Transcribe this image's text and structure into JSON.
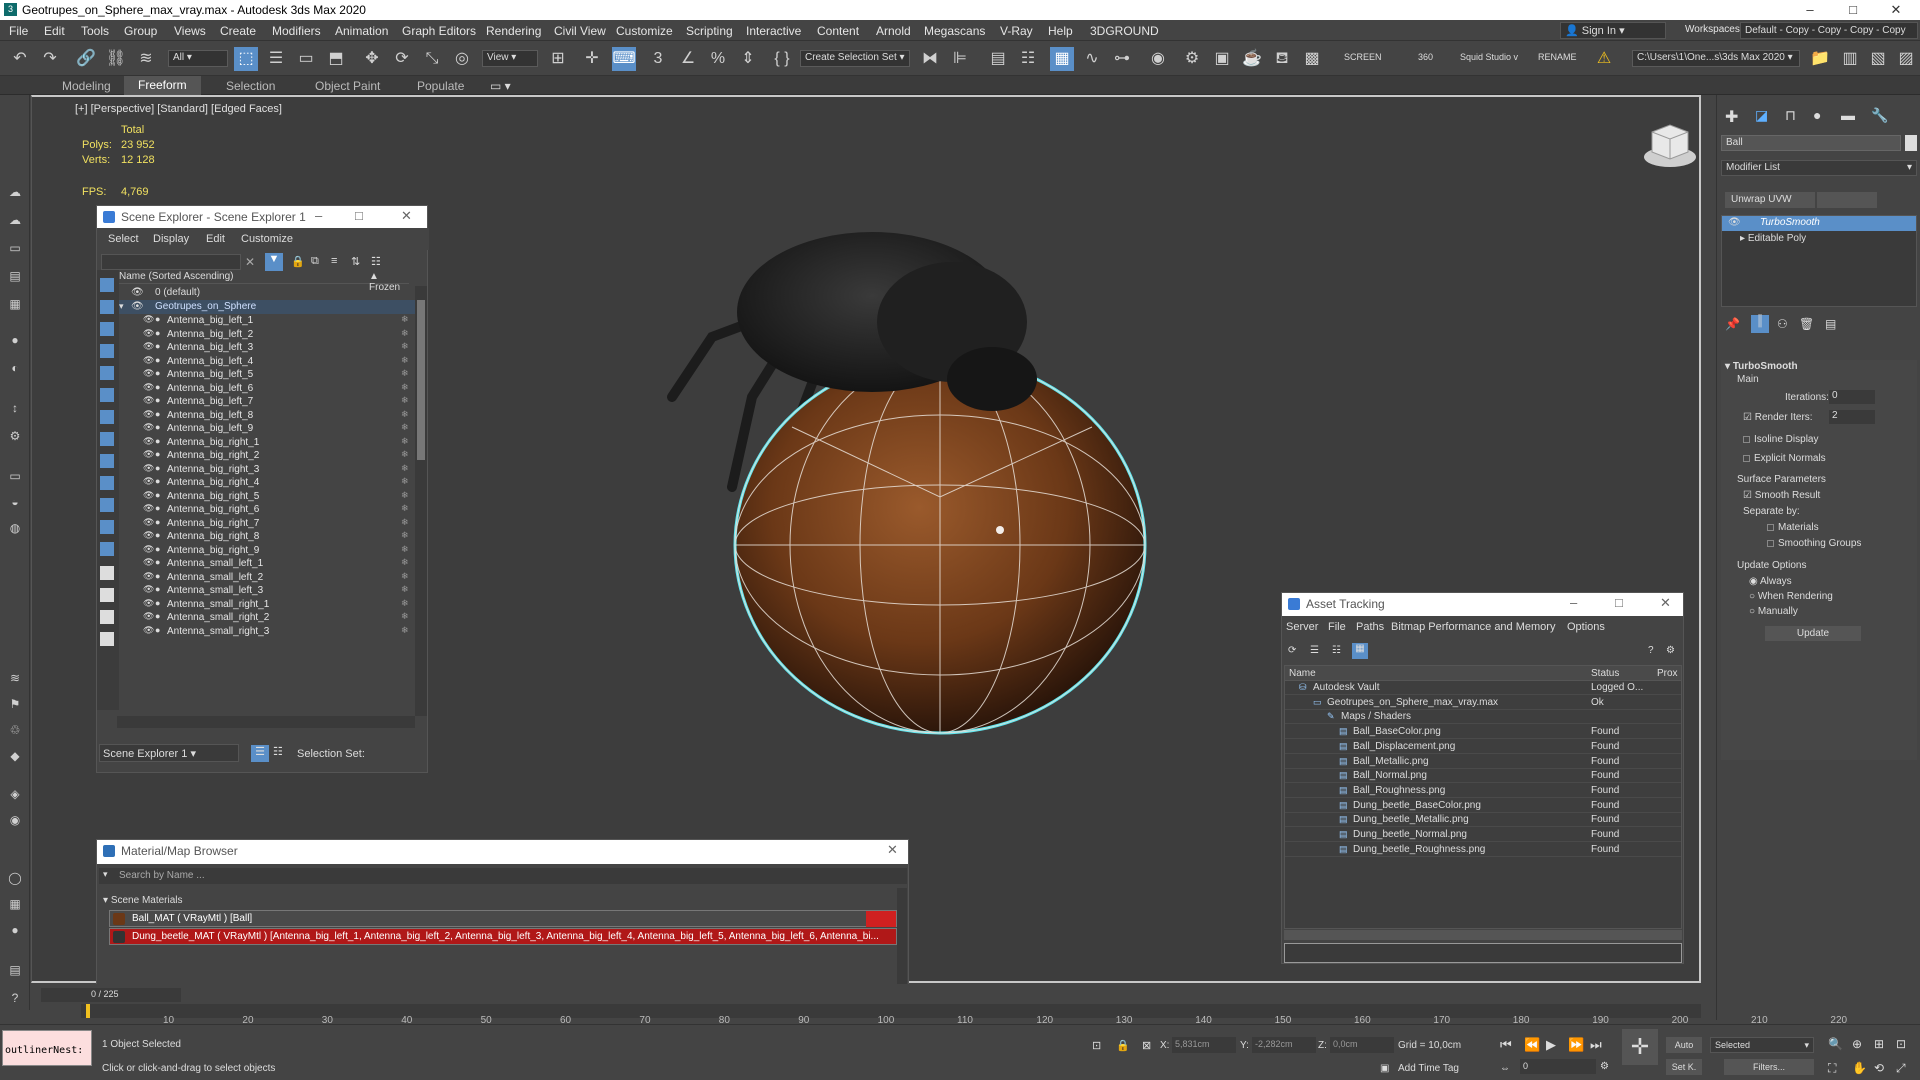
{
  "window": {
    "title": "Geotrupes_on_Sphere_max_vray.max - Autodesk 3ds Max 2020",
    "icon": "3",
    "min": "–",
    "max": "□",
    "close": "✕"
  },
  "menu": [
    "File",
    "Edit",
    "Tools",
    "Group",
    "Views",
    "Create",
    "Modifiers",
    "Animation",
    "Graph Editors",
    "Rendering",
    "Civil View",
    "Customize",
    "Scripting",
    "Interactive",
    "Content",
    "Arnold",
    "Megascans",
    "V-Ray",
    "Help",
    "3DGROUND"
  ],
  "signin": "Sign In",
  "workspace": {
    "label": "Workspaces:",
    "value": "Default - Copy - Copy - Copy - Copy"
  },
  "toolbar": {
    "filter": "All",
    "view": "View",
    "selset": "Create Selection Set",
    "screen": "SCREEN",
    "num": "360",
    "squid": "Squid Studio v",
    "rename": "RENAME",
    "path": "C:\\Users\\1\\One...s\\3ds Max 2020"
  },
  "ribbon": {
    "tabs": [
      "Modeling",
      "Freeform",
      "Selection",
      "Object Paint",
      "Populate"
    ],
    "active": "Freeform"
  },
  "viewport": {
    "label": "[+] [Perspective] [Standard] [Edged Faces]",
    "total": "Total",
    "polys_label": "Polys:",
    "polys": "23 952",
    "verts_label": "Verts:",
    "verts": "12 128",
    "fps_label": "FPS:",
    "fps": "4,769"
  },
  "scene_explorer": {
    "title": "Scene Explorer - Scene Explorer 1",
    "menu": [
      "Select",
      "Display",
      "Edit",
      "Customize"
    ],
    "col_name": "Name (Sorted Ascending)",
    "col_frozen": "▲ Frozen",
    "layer": "0 (default)",
    "root": "Geotrupes_on_Sphere",
    "items": [
      "Antenna_big_left_1",
      "Antenna_big_left_2",
      "Antenna_big_left_3",
      "Antenna_big_left_4",
      "Antenna_big_left_5",
      "Antenna_big_left_6",
      "Antenna_big_left_7",
      "Antenna_big_left_8",
      "Antenna_big_left_9",
      "Antenna_big_right_1",
      "Antenna_big_right_2",
      "Antenna_big_right_3",
      "Antenna_big_right_4",
      "Antenna_big_right_5",
      "Antenna_big_right_6",
      "Antenna_big_right_7",
      "Antenna_big_right_8",
      "Antenna_big_right_9",
      "Antenna_small_left_1",
      "Antenna_small_left_2",
      "Antenna_small_left_3",
      "Antenna_small_right_1",
      "Antenna_small_right_2",
      "Antenna_small_right_3"
    ],
    "footer_name": "Scene Explorer 1",
    "selset": "Selection Set:"
  },
  "material_browser": {
    "title": "Material/Map Browser",
    "search": "Search by Name ...",
    "section": "Scene Materials",
    "items": [
      "Ball_MAT  ( VRayMtl )  [Ball]",
      "Dung_beetle_MAT   ( VRayMtl )   [Antenna_big_left_1,  Antenna_big_left_2,  Antenna_big_left_3,  Antenna_big_left_4,  Antenna_big_left_5,  Antenna_big_left_6,  Antenna_bi..."
    ]
  },
  "asset_tracking": {
    "title": "Asset Tracking",
    "menu": [
      "Server",
      "File",
      "Paths",
      "Bitmap Performance and Memory",
      "Options"
    ],
    "cols": [
      "Name",
      "Status",
      "Prox"
    ],
    "rows": [
      {
        "name": "Autodesk Vault",
        "status": "Logged O..."
      },
      {
        "name": "Geotrupes_on_Sphere_max_vray.max",
        "status": "Ok"
      },
      {
        "name": "Maps / Shaders",
        "status": ""
      },
      {
        "name": "Ball_BaseColor.png",
        "status": "Found"
      },
      {
        "name": "Ball_Displacement.png",
        "status": "Found"
      },
      {
        "name": "Ball_Metallic.png",
        "status": "Found"
      },
      {
        "name": "Ball_Normal.png",
        "status": "Found"
      },
      {
        "name": "Ball_Roughness.png",
        "status": "Found"
      },
      {
        "name": "Dung_beetle_BaseColor.png",
        "status": "Found"
      },
      {
        "name": "Dung_beetle_Metallic.png",
        "status": "Found"
      },
      {
        "name": "Dung_beetle_Normal.png",
        "status": "Found"
      },
      {
        "name": "Dung_beetle_Roughness.png",
        "status": "Found"
      }
    ]
  },
  "command_panel": {
    "object_name": "Ball",
    "modifier_list": "Modifier List",
    "unwrap": "Unwrap UVW",
    "stack": [
      "TurboSmooth",
      "Editable Poly"
    ],
    "rollout": "TurboSmooth",
    "main": "Main",
    "iterations_label": "Iterations:",
    "iterations": "0",
    "render_iters_label": "Render Iters:",
    "render_iters": "2",
    "isoline": "Isoline Display",
    "explicit": "Explicit Normals",
    "surface": "Surface Parameters",
    "smooth_result": "Smooth Result",
    "separate": "Separate by:",
    "materials": "Materials",
    "smoothing": "Smoothing Groups",
    "update_options": "Update Options",
    "always": "Always",
    "when_rendering": "When Rendering",
    "manually": "Manually",
    "update": "Update"
  },
  "timeline": {
    "frame": "0 / 225",
    "ticks": [
      "10",
      "20",
      "30",
      "40",
      "50",
      "60",
      "70",
      "80",
      "90",
      "100",
      "110",
      "120",
      "130",
      "140",
      "150",
      "160",
      "170",
      "180",
      "190",
      "200",
      "210",
      "220"
    ]
  },
  "status": {
    "script": "outlinerNest:",
    "selected": "1 Object Selected",
    "hint": "Click or click-and-drag to select objects",
    "x_label": "X:",
    "x": "5,831cm",
    "y_label": "Y:",
    "y": "-2,282cm",
    "z_label": "Z:",
    "z": "0,0cm",
    "grid": "Grid = 10,0cm",
    "add_time_tag": "Add Time Tag",
    "auto": "Auto",
    "set_k": "Set K.",
    "sel_dropdown": "Selected",
    "filters": "Filters...",
    "frame": "0"
  }
}
